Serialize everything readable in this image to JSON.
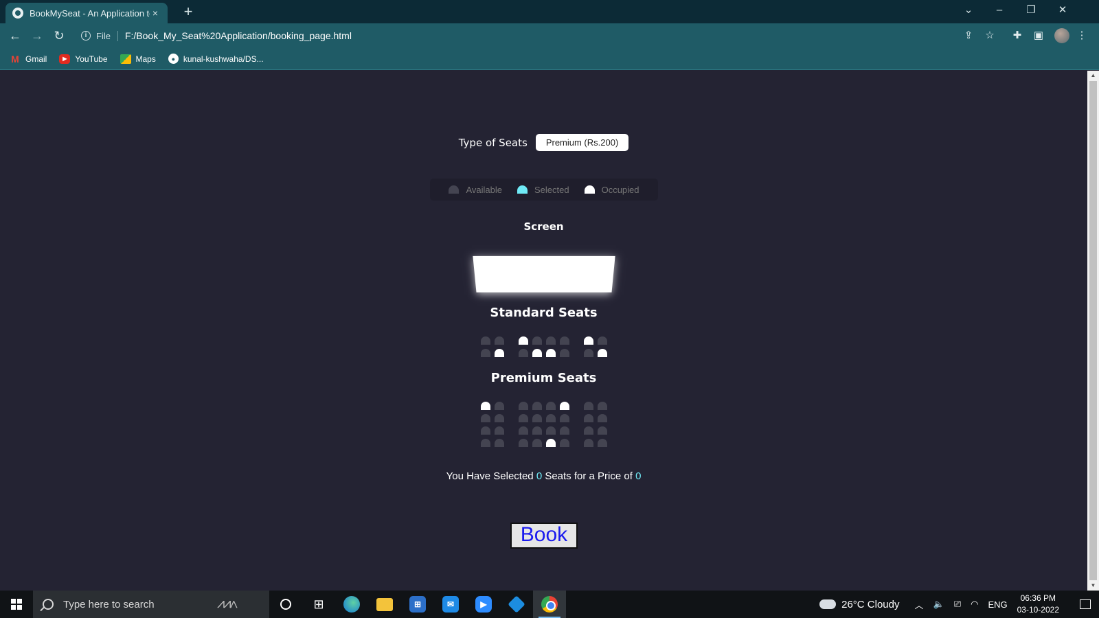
{
  "browser": {
    "tab_title": "BookMySeat - An Application to",
    "tab_close": "×",
    "new_tab": "+",
    "scheme": "File",
    "url": "F:/Book_My_Seat%20Application/booking_page.html",
    "bookmarks": [
      {
        "label": "Gmail",
        "icon": "gmail-icon"
      },
      {
        "label": "YouTube",
        "icon": "youtube-icon"
      },
      {
        "label": "Maps",
        "icon": "maps-icon"
      },
      {
        "label": "kunal-kushwaha/DS...",
        "icon": "github-icon"
      }
    ]
  },
  "page": {
    "type_label": "Type of Seats",
    "type_selected": "Premium (Rs.200)",
    "legend": {
      "available": "Available",
      "selected": "Selected",
      "occupied": "Occupied"
    },
    "screen_label": "Screen",
    "standard_title": "Standard Seats",
    "premium_title": "Premium Seats",
    "standard_rows": [
      [
        0,
        0,
        1,
        0,
        0,
        0,
        1,
        0
      ],
      [
        0,
        1,
        0,
        1,
        1,
        0,
        0,
        1
      ]
    ],
    "premium_rows": [
      [
        1,
        0,
        0,
        0,
        0,
        1,
        0,
        0
      ],
      [
        0,
        0,
        0,
        0,
        0,
        0,
        0,
        0
      ],
      [
        0,
        0,
        0,
        0,
        0,
        0,
        0,
        0
      ],
      [
        0,
        0,
        0,
        0,
        1,
        0,
        0,
        0
      ]
    ],
    "summary_prefix": "You Have Selected",
    "selected_count": "0",
    "summary_middle": "Seats for a Price of",
    "total_price": "0",
    "book_label": "Book"
  },
  "taskbar": {
    "search_placeholder": "Type here to search",
    "weather": "26°C  Cloudy",
    "language": "ENG",
    "time": "06:36 PM",
    "date": "03-10-2022"
  },
  "colors": {
    "page_bg": "#242333",
    "seat_available": "#444451",
    "seat_selected": "#6feaf6",
    "seat_occupied": "#ffffff",
    "browser_accent": "#1f5b66"
  }
}
